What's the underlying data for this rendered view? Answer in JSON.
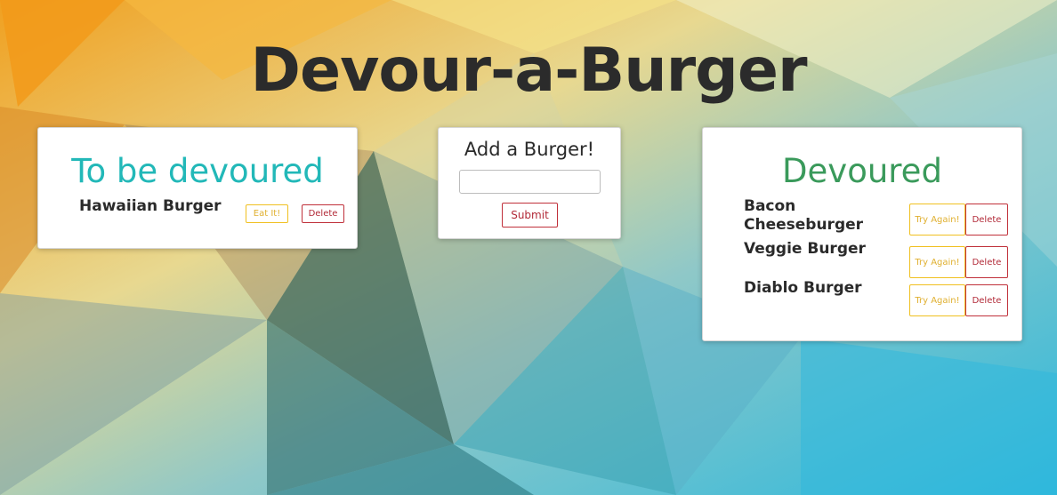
{
  "app": {
    "title": "Devour-a-Burger"
  },
  "to_devour": {
    "heading": "To be devoured",
    "items": [
      {
        "name": "Hawaiian Burger",
        "eat_label": "Eat It!",
        "delete_label": "Delete"
      }
    ]
  },
  "add_burger": {
    "heading": "Add a Burger!",
    "input_value": "",
    "input_placeholder": "",
    "submit_label": "Submit"
  },
  "devoured": {
    "heading": "Devoured",
    "items": [
      {
        "name": "Bacon Cheeseburger",
        "retry_label": "Try Again!",
        "delete_label": "Delete"
      },
      {
        "name": "Veggie Burger",
        "retry_label": "Try Again!",
        "delete_label": "Delete"
      },
      {
        "name": "Diablo Burger",
        "retry_label": "Try Again!",
        "delete_label": "Delete"
      }
    ]
  },
  "colors": {
    "teal_heading": "#22b8b8",
    "green_heading": "#3a9a5b",
    "warning_outline": "#f0c020",
    "danger_outline": "#c0303a"
  }
}
